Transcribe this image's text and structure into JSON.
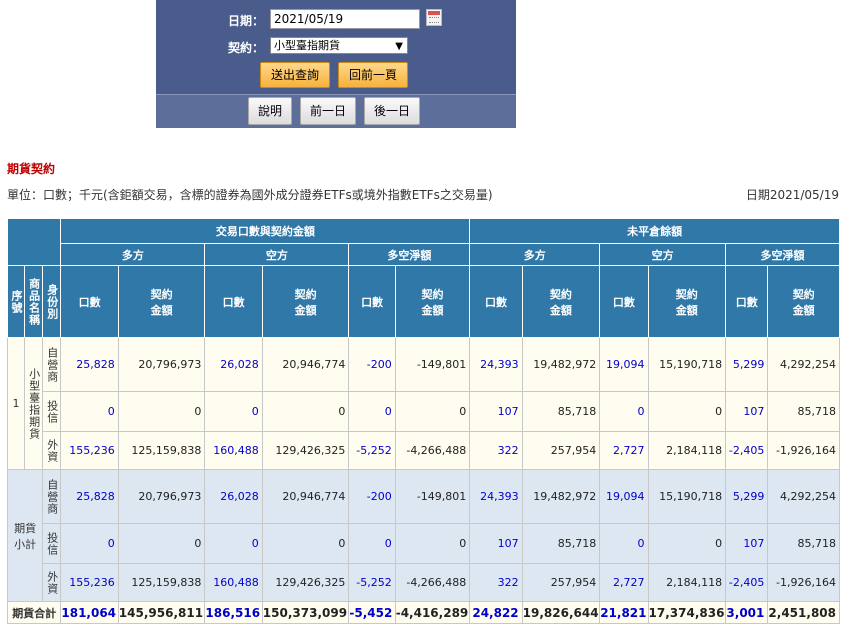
{
  "query": {
    "date_label": "日期：",
    "date_value": "2021/05/19",
    "contract_label": "契約：",
    "contract_selected": "小型臺指期貨",
    "submit_label": "送出查詢",
    "back_label": "回前一頁",
    "help_label": "說明",
    "prev_day_label": "前一日",
    "next_day_label": "後一日"
  },
  "section": {
    "title": "期貨契約",
    "unit_note": "單位：口數；千元(含鉅額交易，含標的證券為國外成分證券ETFs或境外指數ETFs之交易量)",
    "date_note": "日期2021/05/19"
  },
  "table": {
    "header": {
      "trade_group": "交易口數與契約金額",
      "oi_group": "未平倉餘額",
      "long": "多方",
      "short": "空方",
      "net": "多空淨額",
      "seq": "序號",
      "product": "商品名稱",
      "identity": "身份別",
      "lots": "口數",
      "amount": "契約金額"
    },
    "product_block": {
      "seq": "1",
      "name": "小型臺指期貨",
      "rows": [
        {
          "identity": "自營商",
          "vals": [
            "25,828",
            "20,796,973",
            "26,028",
            "20,946,774",
            "-200",
            "-149,801",
            "24,393",
            "19,482,972",
            "19,094",
            "15,190,718",
            "5,299",
            "4,292,254"
          ]
        },
        {
          "identity": "投信",
          "vals": [
            "0",
            "0",
            "0",
            "0",
            "0",
            "0",
            "107",
            "85,718",
            "0",
            "0",
            "107",
            "85,718"
          ]
        },
        {
          "identity": "外資",
          "vals": [
            "155,236",
            "125,159,838",
            "160,488",
            "129,426,325",
            "-5,252",
            "-4,266,488",
            "322",
            "257,954",
            "2,727",
            "2,184,118",
            "-2,405",
            "-1,926,164"
          ]
        }
      ]
    },
    "subtotal_block": {
      "label": "期貨小計",
      "rows": [
        {
          "identity": "自營商",
          "vals": [
            "25,828",
            "20,796,973",
            "26,028",
            "20,946,774",
            "-200",
            "-149,801",
            "24,393",
            "19,482,972",
            "19,094",
            "15,190,718",
            "5,299",
            "4,292,254"
          ]
        },
        {
          "identity": "投信",
          "vals": [
            "0",
            "0",
            "0",
            "0",
            "0",
            "0",
            "107",
            "85,718",
            "0",
            "0",
            "107",
            "85,718"
          ]
        },
        {
          "identity": "外資",
          "vals": [
            "155,236",
            "125,159,838",
            "160,488",
            "129,426,325",
            "-5,252",
            "-4,266,488",
            "322",
            "257,954",
            "2,727",
            "2,184,118",
            "-2,405",
            "-1,926,164"
          ]
        }
      ]
    },
    "total": {
      "label": "期貨合計",
      "vals": [
        "181,064",
        "145,956,811",
        "186,516",
        "150,373,099",
        "-5,452",
        "-4,416,289",
        "24,822",
        "19,826,644",
        "21,821",
        "17,374,836",
        "3,001",
        "2,451,808"
      ]
    }
  }
}
